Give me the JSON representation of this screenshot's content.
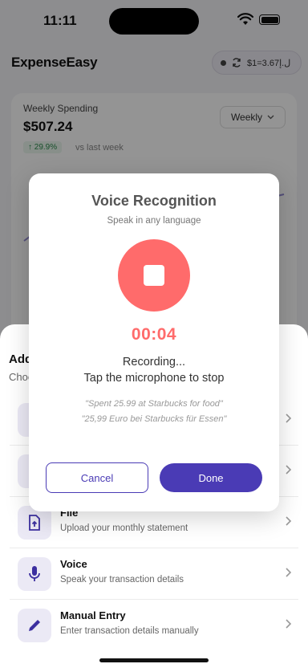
{
  "status_bar": {
    "time": "11:11"
  },
  "header": {
    "app_title": "ExpenseEasy",
    "rate": "$1=3.67ل.إ"
  },
  "spending_card": {
    "label": "Weekly Spending",
    "amount": "$507.24",
    "period": "Weekly",
    "change": "↑ 29.9%",
    "compare": "vs last week"
  },
  "add_sheet": {
    "title": "Add Transaction",
    "subtitle": "Choose how to add",
    "options": [
      {
        "title": "File",
        "desc": "Upload your monthly statement",
        "icon": "upload-file-icon"
      },
      {
        "title": "Voice",
        "desc": "Speak your transaction details",
        "icon": "microphone-icon"
      },
      {
        "title": "Manual Entry",
        "desc": "Enter transaction details manually",
        "icon": "pencil-icon"
      }
    ]
  },
  "voice_modal": {
    "title": "Voice Recognition",
    "subtitle": "Speak in any language",
    "timer": "00:04",
    "status_line1": "Recording...",
    "status_line2": "Tap the microphone to stop",
    "example1": "\"Spent 25.99 at Starbucks for food\"",
    "example2": "\"25,99 Euro bei Starbucks für Essen\"",
    "cancel_label": "Cancel",
    "done_label": "Done"
  },
  "colors": {
    "accent": "#4a3bb5",
    "recording": "#ff6b6b",
    "overlay": "rgba(0,0,0,0.42)"
  }
}
